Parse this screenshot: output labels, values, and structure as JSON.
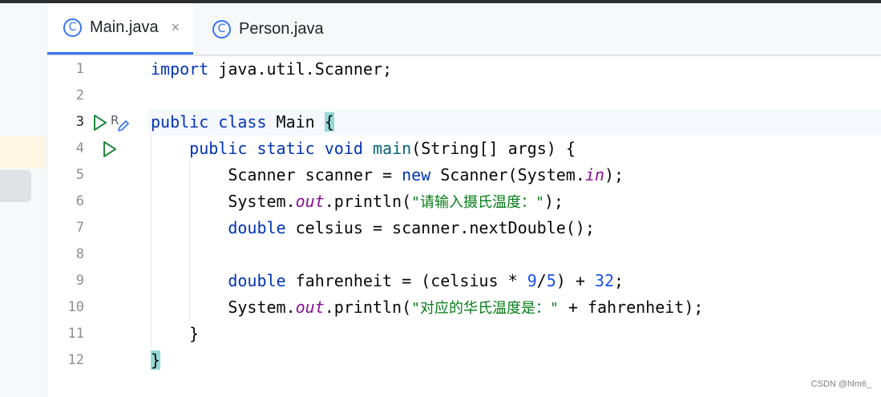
{
  "tabs": [
    {
      "label": "Main.java",
      "icon": "class-icon",
      "icon_glyph": "C",
      "active": true,
      "close": "×"
    },
    {
      "label": "Person.java",
      "icon": "class-icon",
      "icon_glyph": "C",
      "active": false
    }
  ],
  "editor": {
    "line_numbers": [
      "1",
      "2",
      "3",
      "4",
      "5",
      "6",
      "7",
      "8",
      "9",
      "10",
      "11",
      "12"
    ],
    "current_line": "3",
    "line1": {
      "t1": "import",
      "t2": " java.util.Scanner;"
    },
    "line3": {
      "t1": "public",
      "t2": " ",
      "t3": "class",
      "t4": " Main ",
      "t5": "{"
    },
    "line4": {
      "t1": "    ",
      "t2": "public",
      "t3": " ",
      "t4": "static",
      "t5": " ",
      "t6": "void",
      "t7": " ",
      "t8": "main",
      "t9": "(String[] args) {"
    },
    "line5": {
      "t1": "        Scanner scanner = ",
      "t2": "new",
      "t3": " Scanner(System.",
      "t4": "in",
      "t5": ");"
    },
    "line6": {
      "t1": "        System.",
      "t2": "out",
      "t3": ".println(",
      "t4": "\"请输入摄氏温度：\"",
      "t5": ");"
    },
    "line7": {
      "t1": "        ",
      "t2": "double",
      "t3": " celsius = scanner.nextDouble();"
    },
    "line9": {
      "t1": "        ",
      "t2": "double",
      "t3": " fahrenheit = (celsius * ",
      "t4": "9",
      "t5": "/",
      "t6": "5",
      "t7": ") + ",
      "t8": "32",
      "t9": ";"
    },
    "line10": {
      "t1": "        System.",
      "t2": "out",
      "t3": ".println(",
      "t4": "\"对应的华氏温度是：\"",
      "t5": " + fahrenheit);"
    },
    "line11": {
      "t1": "    }"
    },
    "line12": {
      "t1": "}"
    },
    "gutter_marks": {
      "line3": [
        "run-icon",
        "edit-icon"
      ],
      "line3_letter": "R",
      "line4": [
        "run-icon"
      ]
    }
  },
  "watermark": "CSDN @hlm6_",
  "colors": {
    "keyword": "#0033b3",
    "string": "#067d17",
    "number": "#1750eb",
    "static_field": "#871094",
    "method": "#00627a",
    "accent": "#3574f0",
    "brace_match": "#93d9d9"
  }
}
